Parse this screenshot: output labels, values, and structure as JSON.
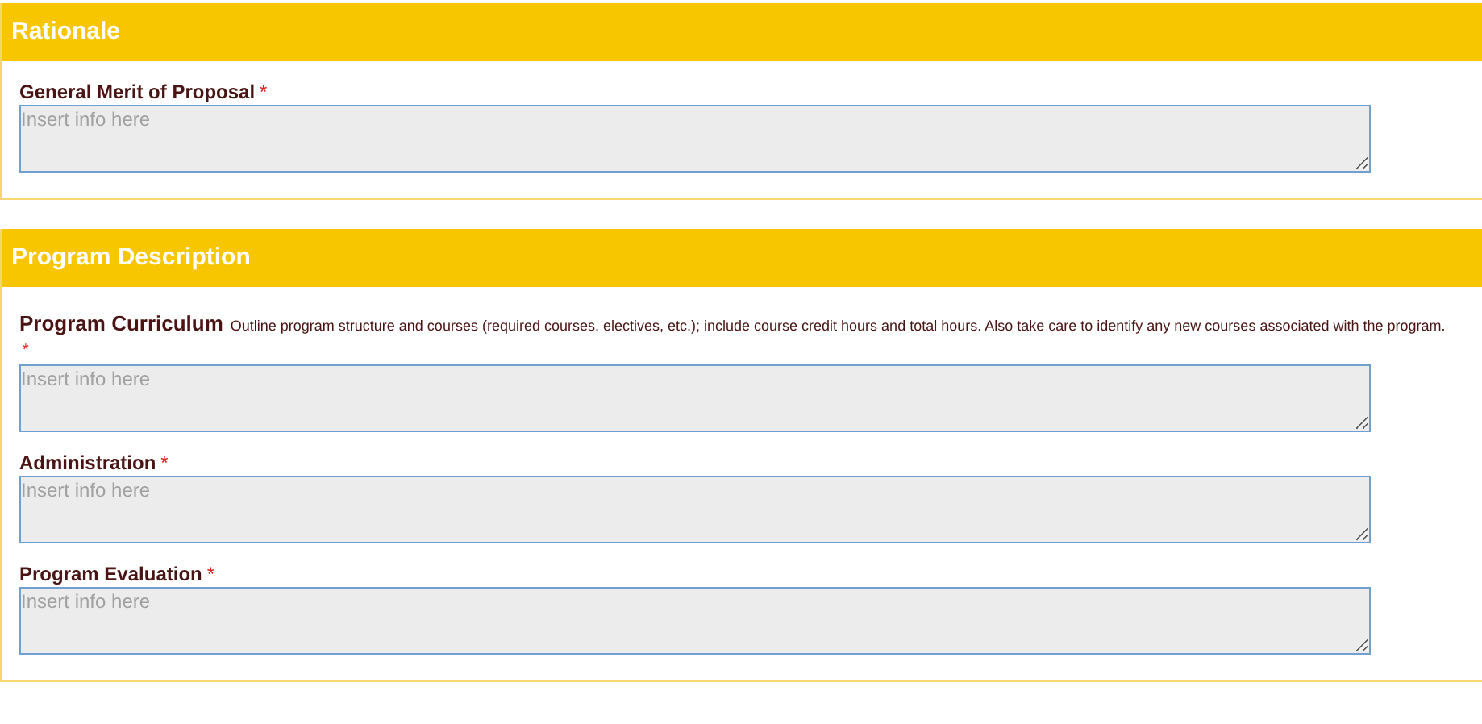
{
  "sections": [
    {
      "title": "Rationale",
      "fields": [
        {
          "label": "General Merit of Proposal",
          "required_mark": "*",
          "placeholder": "Insert info here"
        }
      ]
    },
    {
      "title": "Program Description",
      "fields": [
        {
          "label": "Program Curriculum",
          "description": "Outline program structure and courses (required courses, electives, etc.); include course credit hours and total hours. Also take care to identify any new courses associated with the program.",
          "required_mark": "*",
          "placeholder": "Insert info here"
        },
        {
          "label": "Administration",
          "required_mark": "*",
          "placeholder": "Insert info here"
        },
        {
          "label": "Program Evaluation",
          "required_mark": "*",
          "placeholder": "Insert info here"
        }
      ]
    }
  ]
}
